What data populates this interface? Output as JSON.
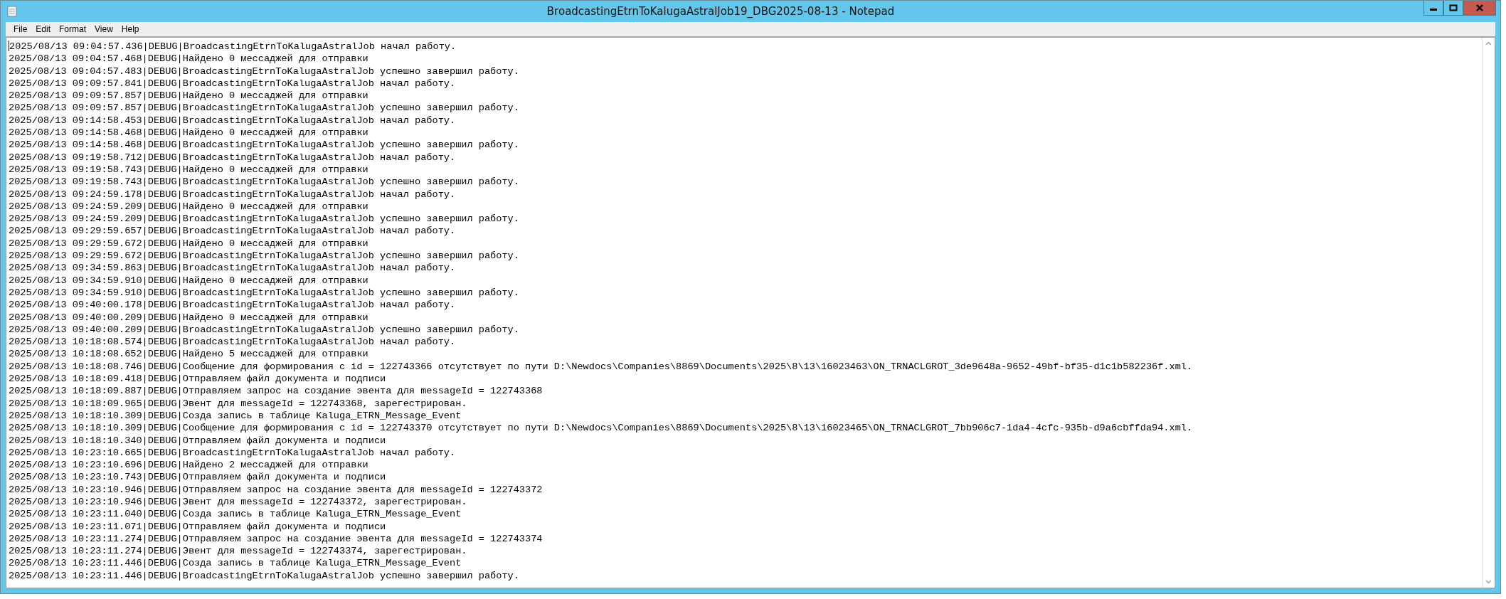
{
  "window": {
    "title": "BroadcastingEtrnToKalugaAstralJob19_DBG2025-08-13 - Notepad"
  },
  "menu": [
    "File",
    "Edit",
    "Format",
    "View",
    "Help"
  ],
  "editor": {
    "lines": [
      "2025/08/13 09:04:57.436|DEBUG|BroadcastingEtrnToKalugaAstralJob начал работу.",
      "2025/08/13 09:04:57.468|DEBUG|Найдено 0 мессаджей для отправки",
      "2025/08/13 09:04:57.483|DEBUG|BroadcastingEtrnToKalugaAstralJob успешно завершил работу.",
      "2025/08/13 09:09:57.841|DEBUG|BroadcastingEtrnToKalugaAstralJob начал работу.",
      "2025/08/13 09:09:57.857|DEBUG|Найдено 0 мессаджей для отправки",
      "2025/08/13 09:09:57.857|DEBUG|BroadcastingEtrnToKalugaAstralJob успешно завершил работу.",
      "2025/08/13 09:14:58.453|DEBUG|BroadcastingEtrnToKalugaAstralJob начал работу.",
      "2025/08/13 09:14:58.468|DEBUG|Найдено 0 мессаджей для отправки",
      "2025/08/13 09:14:58.468|DEBUG|BroadcastingEtrnToKalugaAstralJob успешно завершил работу.",
      "2025/08/13 09:19:58.712|DEBUG|BroadcastingEtrnToKalugaAstralJob начал работу.",
      "2025/08/13 09:19:58.743|DEBUG|Найдено 0 мессаджей для отправки",
      "2025/08/13 09:19:58.743|DEBUG|BroadcastingEtrnToKalugaAstralJob успешно завершил работу.",
      "2025/08/13 09:24:59.178|DEBUG|BroadcastingEtrnToKalugaAstralJob начал работу.",
      "2025/08/13 09:24:59.209|DEBUG|Найдено 0 мессаджей для отправки",
      "2025/08/13 09:24:59.209|DEBUG|BroadcastingEtrnToKalugaAstralJob успешно завершил работу.",
      "2025/08/13 09:29:59.657|DEBUG|BroadcastingEtrnToKalugaAstralJob начал работу.",
      "2025/08/13 09:29:59.672|DEBUG|Найдено 0 мессаджей для отправки",
      "2025/08/13 09:29:59.672|DEBUG|BroadcastingEtrnToKalugaAstralJob успешно завершил работу.",
      "2025/08/13 09:34:59.863|DEBUG|BroadcastingEtrnToKalugaAstralJob начал работу.",
      "2025/08/13 09:34:59.910|DEBUG|Найдено 0 мессаджей для отправки",
      "2025/08/13 09:34:59.910|DEBUG|BroadcastingEtrnToKalugaAstralJob успешно завершил работу.",
      "2025/08/13 09:40:00.178|DEBUG|BroadcastingEtrnToKalugaAstralJob начал работу.",
      "2025/08/13 09:40:00.209|DEBUG|Найдено 0 мессаджей для отправки",
      "2025/08/13 09:40:00.209|DEBUG|BroadcastingEtrnToKalugaAstralJob успешно завершил работу.",
      "2025/08/13 10:18:08.574|DEBUG|BroadcastingEtrnToKalugaAstralJob начал работу.",
      "2025/08/13 10:18:08.652|DEBUG|Найдено 5 мессаджей для отправки",
      "2025/08/13 10:18:08.746|DEBUG|Сообщение для формирования с id = 122743366 отсутствует по пути D:\\Newdocs\\Companies\\8869\\Documents\\2025\\8\\13\\16023463\\ON_TRNACLGROT_3de9648a-9652-49bf-bf35-d1c1b582236f.xml.",
      "2025/08/13 10:18:09.418|DEBUG|Отправляем файл документа и подписи",
      "2025/08/13 10:18:09.887|DEBUG|Отправляем запрос на создание эвента для messageId = 122743368",
      "2025/08/13 10:18:09.965|DEBUG|Эвент для messageId = 122743368, зарегестрирован.",
      "2025/08/13 10:18:10.309|DEBUG|Созда запись в таблице Kaluga_ETRN_Message_Event",
      "2025/08/13 10:18:10.309|DEBUG|Сообщение для формирования с id = 122743370 отсутствует по пути D:\\Newdocs\\Companies\\8869\\Documents\\2025\\8\\13\\16023465\\ON_TRNACLGROT_7bb906c7-1da4-4cfc-935b-d9a6cbffda94.xml.",
      "2025/08/13 10:18:10.340|DEBUG|Отправляем файл документа и подписи",
      "2025/08/13 10:23:10.665|DEBUG|BroadcastingEtrnToKalugaAstralJob начал работу.",
      "2025/08/13 10:23:10.696|DEBUG|Найдено 2 мессаджей для отправки",
      "2025/08/13 10:23:10.743|DEBUG|Отправляем файл документа и подписи",
      "2025/08/13 10:23:10.946|DEBUG|Отправляем запрос на создание эвента для messageId = 122743372",
      "2025/08/13 10:23:10.946|DEBUG|Эвент для messageId = 122743372, зарегестрирован.",
      "2025/08/13 10:23:11.040|DEBUG|Созда запись в таблице Kaluga_ETRN_Message_Event",
      "2025/08/13 10:23:11.071|DEBUG|Отправляем файл документа и подписи",
      "2025/08/13 10:23:11.274|DEBUG|Отправляем запрос на создание эвента для messageId = 122743374",
      "2025/08/13 10:23:11.274|DEBUG|Эвент для messageId = 122743374, зарегестрирован.",
      "2025/08/13 10:23:11.446|DEBUG|Созда запись в таблице Kaluga_ETRN_Message_Event",
      "2025/08/13 10:23:11.446|DEBUG|BroadcastingEtrnToKalugaAstralJob успешно завершил работу."
    ]
  }
}
